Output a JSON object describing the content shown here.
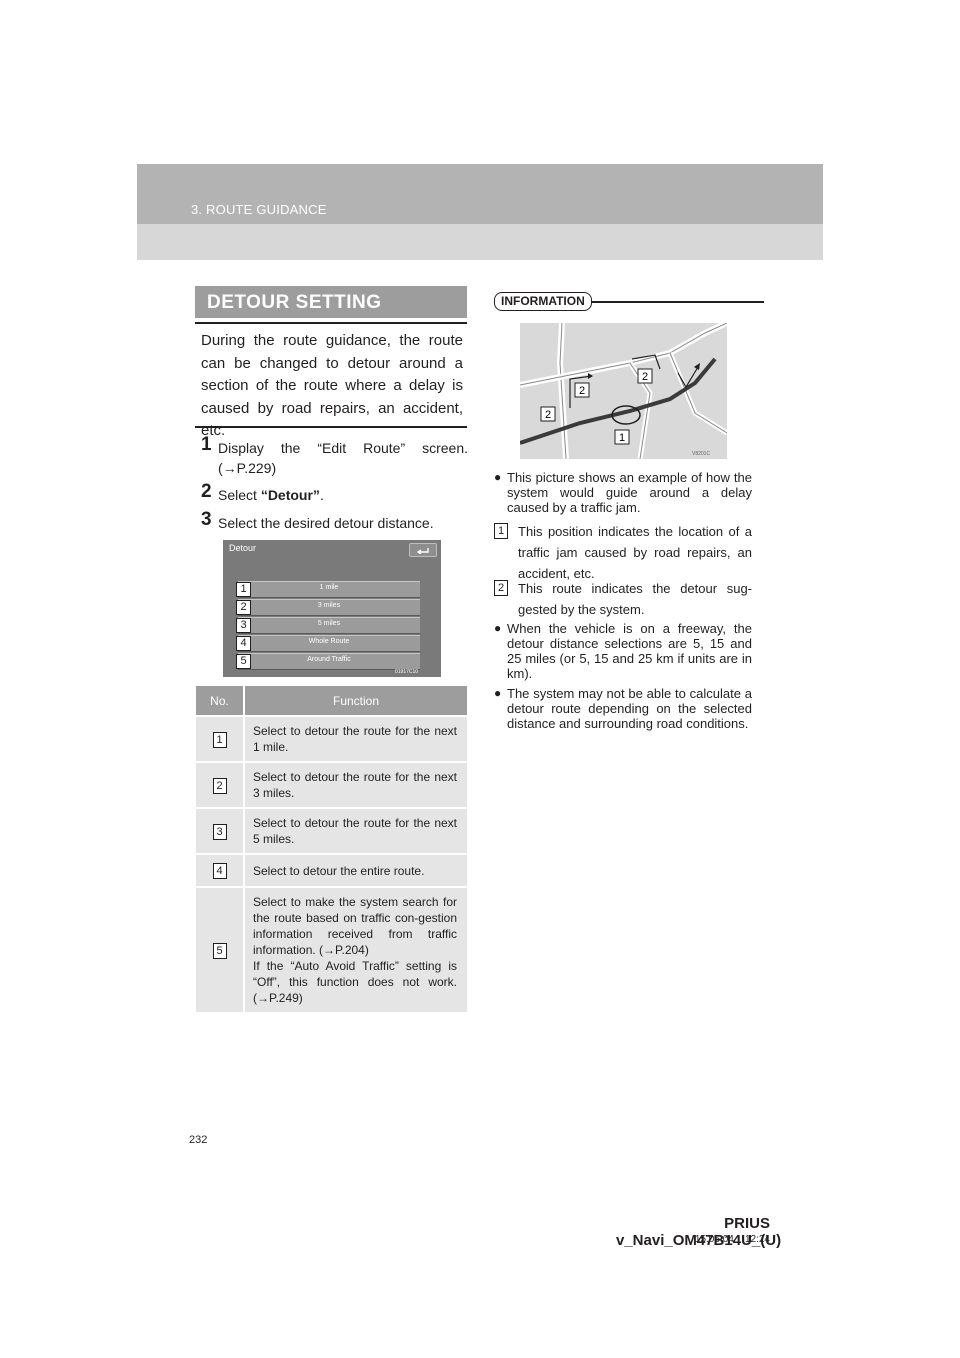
{
  "header": {
    "section": "3. ROUTE GUIDANCE"
  },
  "left": {
    "heading": "DETOUR SETTING",
    "intro": "During the route guidance, the route can be changed to detour around a section of the route where a delay is caused by road repairs, an accident, etc.",
    "steps": [
      {
        "num": "1",
        "text": "Display the “Edit Route” screen. (→P.229)"
      },
      {
        "num": "2",
        "pre": "Select ",
        "bold": "“Detour”",
        "post": "."
      },
      {
        "num": "3",
        "text": "Select the desired detour distance."
      }
    ],
    "screen": {
      "title": "Detour",
      "buttons": [
        "1 mile",
        "3 miles",
        "5 miles",
        "Whole Route",
        "Around Traffic"
      ],
      "callouts": [
        "1",
        "2",
        "3",
        "4",
        "5"
      ],
      "code": "01917C10"
    },
    "table": {
      "headers": [
        "No.",
        "Function"
      ],
      "rows": [
        {
          "num": "1",
          "text": "Select to detour the route for the next 1 mile."
        },
        {
          "num": "2",
          "text": "Select to detour the route for the next 3 miles."
        },
        {
          "num": "3",
          "text": "Select to detour the route for the next 5 miles."
        },
        {
          "num": "4",
          "text": "Select to detour the entire route."
        },
        {
          "num": "5",
          "text": "Select to make the system search for the route based on traffic con-gestion information received from traffic information. (→P.204)",
          "text2": "If the “Auto Avoid Traffic” setting is “Off”, this function does not work. (→P.249)"
        }
      ]
    }
  },
  "right": {
    "info_label": "INFORMATION",
    "map": {
      "labels": [
        "2",
        "2",
        "2",
        "1"
      ],
      "code": "V8201C"
    },
    "bullet1": "This picture shows an example of how the system would guide around a delay caused by a traffic jam.",
    "item1": {
      "num": "1",
      "text": "This position indicates the location of a traffic jam caused by road repairs, an accident, etc."
    },
    "item2": {
      "num": "2",
      "text": "This route indicates the detour sug-gested by the system."
    },
    "bullet2": "When the vehicle is on a freeway, the detour distance selections are 5, 15 and 25 miles (or 5, 15 and 25 km if units are in km).",
    "bullet3": "The system may not be able to calculate a detour route depending on the selected distance and surrounding road conditions."
  },
  "footer": {
    "page": "232",
    "doc": "PRIUS v_Navi_OM47B14U_(U)",
    "date": "15.06.04",
    "time": "12:24"
  }
}
